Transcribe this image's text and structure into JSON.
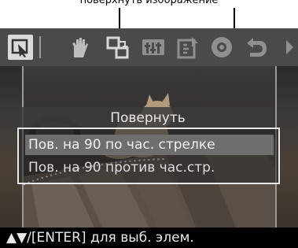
{
  "caption": {
    "text": "поверхнуть изображение"
  },
  "toolbar": {
    "icons": [
      "select-icon",
      "pan-hand-icon",
      "rotate-icon",
      "adjust-sliders-icon",
      "edit-filter-icon",
      "red-eye-icon",
      "undo-icon",
      "next-arrow-icon"
    ],
    "selected": "select-icon"
  },
  "menu": {
    "title": "Повернуть",
    "items": [
      {
        "label": "Пов. на 90 по час. стрелке",
        "selected": true
      },
      {
        "label": "Пов. на 90 против час.стр.",
        "selected": false
      }
    ]
  },
  "status": {
    "hint": "▲▼/[ENTER] для выб. элем."
  },
  "colors": {
    "toolbar": "#4a4a4a",
    "highlight": "#6e6e6e",
    "border": "#e8e8e8",
    "status_bar": "#000000"
  }
}
